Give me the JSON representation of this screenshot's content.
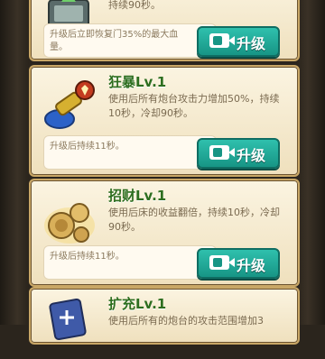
{
  "skills": [
    {
      "title": "",
      "description": "持续90秒。",
      "upgrade_note": "升级后立即恢复门35%的最大血量。",
      "upgrade_button": "升级",
      "icon": "repair-kit-icon"
    },
    {
      "title": "狂暴Lv.1",
      "description": "使用后所有炮台攻击力增加50%，持续10秒，冷却90秒。",
      "upgrade_note": "升级后持续11秒。",
      "upgrade_button": "升级",
      "icon": "rage-cannon-icon"
    },
    {
      "title": "招财Lv.1",
      "description": "使用后床的收益翻倍，持续10秒，冷却90秒。",
      "upgrade_note": "升级后持续11秒。",
      "upgrade_button": "升级",
      "icon": "fortune-coins-icon"
    },
    {
      "title": "扩充Lv.1",
      "description": "使用后所有的炮台的攻击范围增加3",
      "upgrade_note": "",
      "upgrade_button": "",
      "icon": "expand-card-icon"
    }
  ],
  "colors": {
    "title_green": "#2d6e1f",
    "button_teal": "#1fa896",
    "card_bg": "#fbf4e1"
  }
}
